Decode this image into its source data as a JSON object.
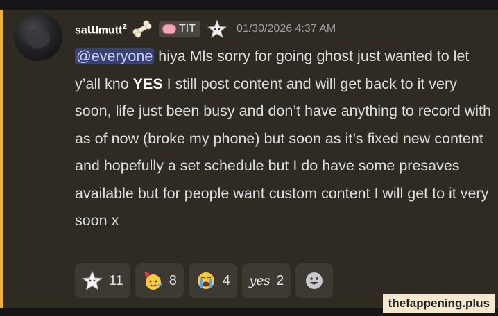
{
  "message": {
    "author": {
      "name_prefix": "sa",
      "name_stylized": "ɯ",
      "name_suffix": "mutt",
      "name_super": "z",
      "avatar_icon": "dark-portrait-avatar"
    },
    "badges": {
      "decoration_icon": "bone-icon",
      "role_icon": "brain-icon",
      "role_label": "TIT",
      "extra_badge_icon": "star-icon"
    },
    "timestamp": "01/30/2026 4:37 AM",
    "mention": "@everyone",
    "text_part1": " hiya Mls sorry for going ghost just wanted to let y’all kno ",
    "emphasis": "YES",
    "text_part2": " I still post content and will get back to it very soon, life just been busy and don’t have anything to record with as of now (broke my phone) but soon as it’s fixed new content and hopefully a set schedule but I do have some presaves available but for people want custom content I will get to it very soon x",
    "accent_color": "#f0b232"
  },
  "reactions": [
    {
      "emoji": "star-face-icon",
      "count": "11"
    },
    {
      "emoji": "party-face-icon",
      "count": "8"
    },
    {
      "emoji": "crying-face-icon",
      "count": "4"
    },
    {
      "emoji": "yes-text-icon",
      "label": "yes",
      "count": "2"
    }
  ],
  "add_reaction_icon": "smiley-add-reaction-icon",
  "watermark": "thefappening.plus"
}
